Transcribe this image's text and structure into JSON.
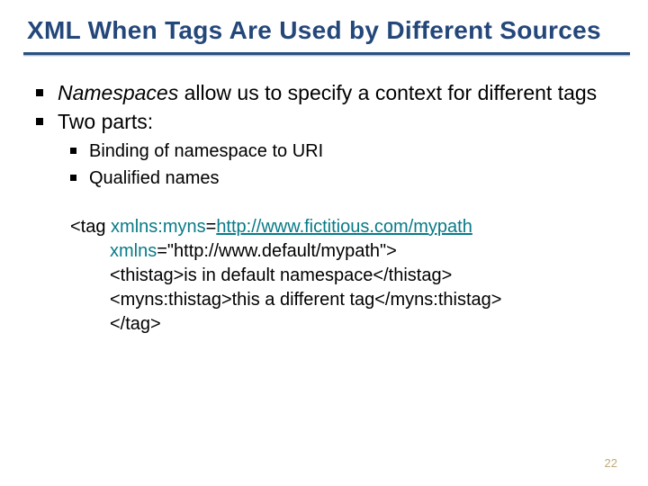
{
  "title": "XML When Tags Are Used by Different Sources",
  "bullets_l1": [
    {
      "italic": "Namespaces",
      "rest": "  allow us to specify a context for different tags"
    },
    {
      "italic": "",
      "rest": "Two parts:"
    }
  ],
  "bullets_l2": [
    "Binding of namespace to URI",
    "Qualified names"
  ],
  "code": {
    "l1": {
      "a": "<tag ",
      "b": "xmlns:myns",
      "c": "=",
      "d": "http://www.fictitious.com/mypath"
    },
    "l2": {
      "a": "xmlns",
      "b": "=\"http://www.default/mypath\">"
    },
    "l3": "<thistag>is in default namespace</thistag>",
    "l4": "<myns:thistag>this a different tag</myns:thistag>",
    "l5": "</tag>"
  },
  "page_number": "22"
}
